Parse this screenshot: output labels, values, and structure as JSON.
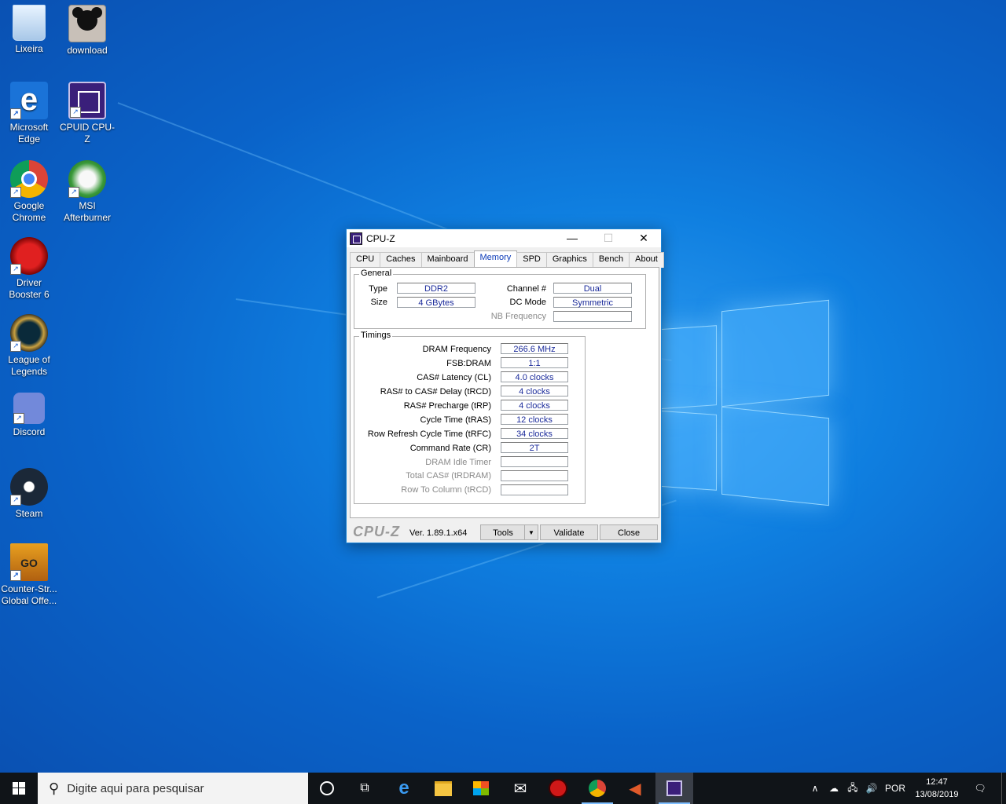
{
  "desktop": {
    "icons": [
      {
        "label": "Lixeira",
        "icon": "recycle-bin-icon"
      },
      {
        "label": "download",
        "icon": "mickey-image-icon"
      },
      {
        "label": "Microsoft Edge",
        "icon": "edge-icon"
      },
      {
        "label": "CPUID CPU-Z",
        "icon": "cpuz-icon"
      },
      {
        "label": "Google Chrome",
        "icon": "chrome-icon"
      },
      {
        "label": "MSI Afterburner",
        "icon": "afterburner-icon"
      },
      {
        "label": "Driver Booster 6",
        "icon": "driver-booster-icon"
      },
      {
        "label": "League of Legends",
        "icon": "league-icon"
      },
      {
        "label": "Discord",
        "icon": "discord-icon"
      },
      {
        "label": "Steam",
        "icon": "steam-icon"
      },
      {
        "label": "Counter-Str... Global Offe...",
        "icon": "csgo-icon"
      }
    ]
  },
  "cpuz": {
    "title": "CPU-Z",
    "tabs": [
      "CPU",
      "Caches",
      "Mainboard",
      "Memory",
      "SPD",
      "Graphics",
      "Bench",
      "About"
    ],
    "active_tab": "Memory",
    "general": {
      "legend": "General",
      "type_label": "Type",
      "type_value": "DDR2",
      "size_label": "Size",
      "size_value": "4 GBytes",
      "channel_label": "Channel #",
      "channel_value": "Dual",
      "dcmode_label": "DC Mode",
      "dcmode_value": "Symmetric",
      "nbfreq_label": "NB Frequency",
      "nbfreq_value": ""
    },
    "timings": {
      "legend": "Timings",
      "rows": [
        {
          "label": "DRAM Frequency",
          "value": "266.6 MHz"
        },
        {
          "label": "FSB:DRAM",
          "value": "1:1"
        },
        {
          "label": "CAS# Latency (CL)",
          "value": "4.0 clocks"
        },
        {
          "label": "RAS# to CAS# Delay (tRCD)",
          "value": "4 clocks"
        },
        {
          "label": "RAS# Precharge (tRP)",
          "value": "4 clocks"
        },
        {
          "label": "Cycle Time (tRAS)",
          "value": "12 clocks"
        },
        {
          "label": "Row Refresh Cycle Time (tRFC)",
          "value": "34 clocks"
        },
        {
          "label": "Command Rate (CR)",
          "value": "2T"
        },
        {
          "label": "DRAM Idle Timer",
          "value": ""
        },
        {
          "label": "Total CAS# (tRDRAM)",
          "value": ""
        },
        {
          "label": "Row To Column (tRCD)",
          "value": ""
        }
      ]
    },
    "footer": {
      "brand": "CPU-Z",
      "version": "Ver. 1.89.1.x64",
      "tools": "Tools",
      "validate": "Validate",
      "close": "Close"
    }
  },
  "taskbar": {
    "search_placeholder": "Digite aqui para pesquisar",
    "language": "POR",
    "time": "12:47",
    "date": "13/08/2019"
  }
}
